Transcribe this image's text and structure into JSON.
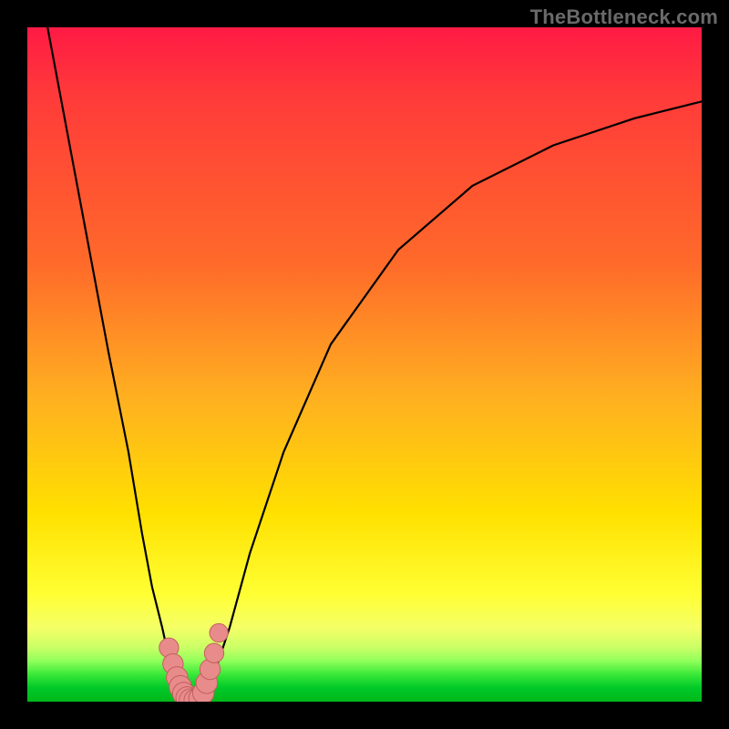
{
  "watermark": "TheBottleneck.com",
  "colors": {
    "background_frame": "#000000",
    "curve": "#000000",
    "bead_fill": "#e88b8b",
    "bead_stroke": "#c45f5f",
    "gradient_top": "#ff1a44",
    "gradient_bottom": "#00b81a"
  },
  "chart_data": {
    "type": "line",
    "title": "",
    "xlabel": "",
    "ylabel": "",
    "xlim": [
      0,
      100
    ],
    "ylim": [
      0,
      100
    ],
    "note": "No numeric axes or tick labels shown; two black curves meeting near bottom with pink bead markers. x/y values estimated from pixel positions on a 0–100 normalized grid.",
    "series": [
      {
        "name": "left-curve",
        "x": [
          3,
          6,
          9,
          12,
          15,
          17,
          18.5,
          20,
          21,
          22,
          22.8,
          23.5
        ],
        "y": [
          100,
          84,
          68,
          52,
          37,
          25,
          17,
          11,
          6.5,
          3.5,
          1.5,
          0.5
        ]
      },
      {
        "name": "right-curve",
        "x": [
          26,
          27,
          28,
          30,
          33,
          38,
          45,
          55,
          66,
          78,
          90,
          100
        ],
        "y": [
          0.5,
          2,
          5,
          11,
          22,
          37,
          53,
          67,
          76.5,
          82.5,
          86.5,
          89
        ]
      },
      {
        "name": "valley-floor",
        "x": [
          23.5,
          24,
          24.6,
          25.2,
          26
        ],
        "y": [
          0.5,
          0.1,
          0.05,
          0.1,
          0.5
        ]
      }
    ],
    "markers": [
      {
        "x": 21.0,
        "y": 8.0,
        "r": 1.2
      },
      {
        "x": 21.6,
        "y": 5.6,
        "r": 1.3
      },
      {
        "x": 22.2,
        "y": 3.6,
        "r": 1.4
      },
      {
        "x": 22.7,
        "y": 2.2,
        "r": 1.5
      },
      {
        "x": 23.2,
        "y": 1.2,
        "r": 1.5
      },
      {
        "x": 23.7,
        "y": 0.55,
        "r": 1.5
      },
      {
        "x": 24.2,
        "y": 0.25,
        "r": 1.5
      },
      {
        "x": 24.9,
        "y": 0.2,
        "r": 1.5
      },
      {
        "x": 25.6,
        "y": 0.5,
        "r": 1.5
      },
      {
        "x": 26.1,
        "y": 1.3,
        "r": 1.4
      },
      {
        "x": 26.6,
        "y": 2.8,
        "r": 1.4
      },
      {
        "x": 27.1,
        "y": 4.8,
        "r": 1.3
      },
      {
        "x": 27.7,
        "y": 7.2,
        "r": 1.2
      },
      {
        "x": 28.4,
        "y": 10.2,
        "r": 1.1
      }
    ]
  }
}
